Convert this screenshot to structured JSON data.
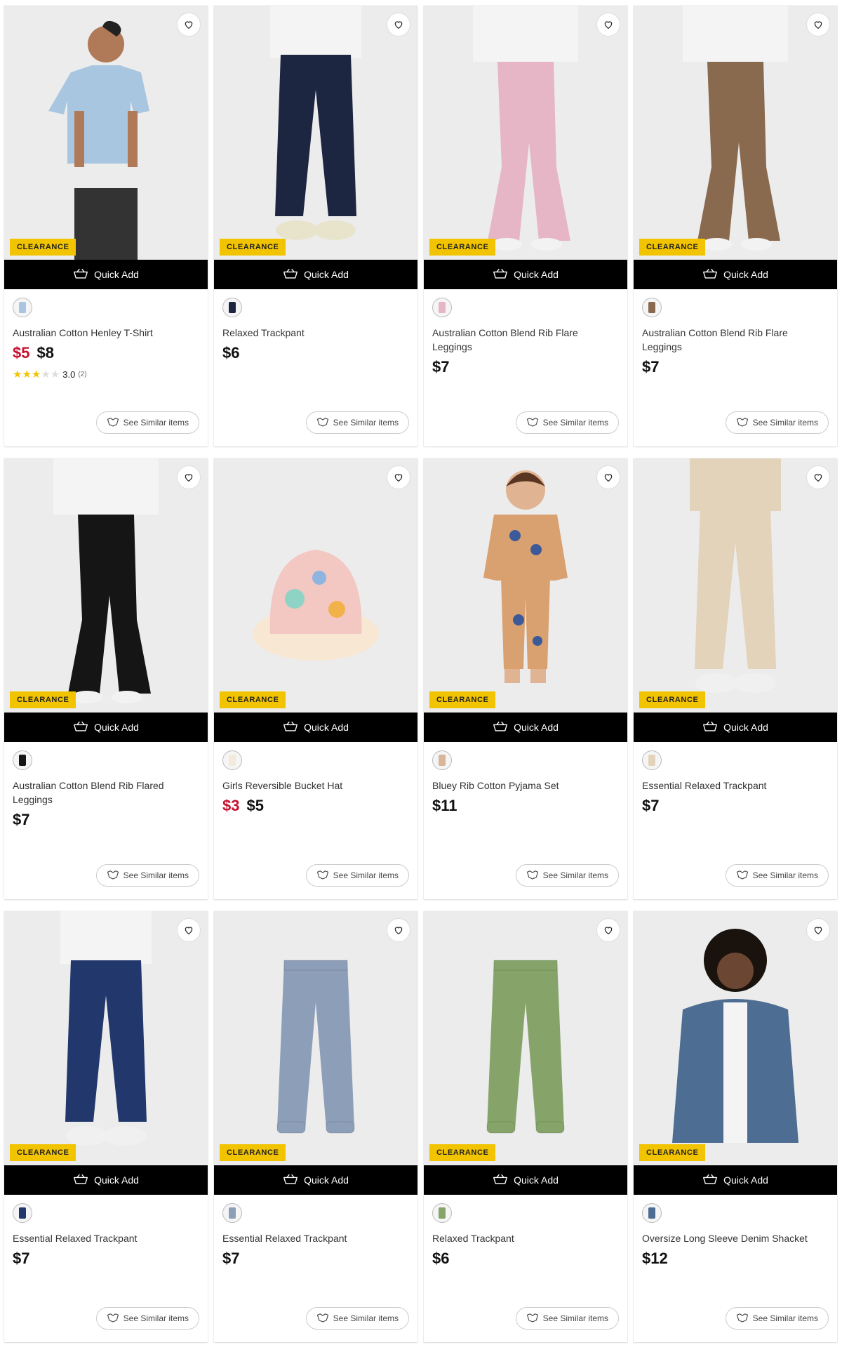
{
  "common": {
    "badge": "CLEARANCE",
    "quick_add": "Quick Add",
    "see_similar": "See Similar items"
  },
  "colors": {
    "badge_bg": "#f2c400",
    "sale_price": "#c8102e",
    "quick_add_bg": "#000000"
  },
  "products": [
    {
      "name": "Australian Cotton Henley T-Shirt",
      "sale_price": "$5",
      "price": "$8",
      "rating": "3.0",
      "rating_count": "(2)",
      "stars": 3,
      "swatch": "#a8c6e0",
      "photo": {
        "kind": "tee",
        "top": "#a8c6e0",
        "bottom": "#333333",
        "skin": "#b07a58"
      }
    },
    {
      "name": "Relaxed Trackpant",
      "sale_price": "",
      "price": "$6",
      "photo": {
        "kind": "pants",
        "top": "#f4f4f4",
        "bottom": "#1c2640",
        "shoe": "#e8e4cc"
      },
      "swatch": "#1c2640"
    },
    {
      "name": "Australian Cotton Blend Rib Flare Leggings",
      "sale_price": "",
      "price": "$7",
      "photo": {
        "kind": "flare",
        "top": "#f4f4f4",
        "bottom": "#e6b6c6",
        "shoe": "#f2f2f2"
      },
      "swatch": "#e6b6c6"
    },
    {
      "name": "Australian Cotton Blend Rib Flare Leggings",
      "sale_price": "",
      "price": "$7",
      "photo": {
        "kind": "flare",
        "top": "#f4f4f4",
        "bottom": "#8a6a4e",
        "shoe": "#f2f2f2"
      },
      "swatch": "#8a6a4e"
    },
    {
      "name": "Australian Cotton Blend Rib Flared Leggings",
      "sale_price": "",
      "price": "$7",
      "photo": {
        "kind": "flare",
        "top": "#f4f4f4",
        "bottom": "#151515",
        "shoe": "#f2f2f2"
      },
      "swatch": "#151515"
    },
    {
      "name": "Girls Reversible Bucket Hat",
      "sale_price": "$3",
      "price": "$5",
      "photo": {
        "kind": "hat",
        "top": "#f7e7d3",
        "bottom": "#f3c7c2",
        "shoe": "#8ed3c6"
      },
      "swatch": "#f4ead9"
    },
    {
      "name": "Bluey Rib Cotton Pyjama Set",
      "sale_price": "",
      "price": "$11",
      "photo": {
        "kind": "pyjama",
        "top": "#d9a070",
        "bottom": "#d9a070",
        "skin": "#e0b392"
      },
      "swatch": "#d9b59a"
    },
    {
      "name": "Essential Relaxed Trackpant",
      "sale_price": "",
      "price": "$7",
      "photo": {
        "kind": "pants",
        "top": "#e3d3bb",
        "bottom": "#e3d3bb",
        "shoe": "#f0f0f0"
      },
      "swatch": "#e3d3bb"
    },
    {
      "name": "Essential Relaxed Trackpant",
      "sale_price": "",
      "price": "$7",
      "photo": {
        "kind": "pants",
        "top": "#f4f4f4",
        "bottom": "#22376b",
        "shoe": "#f0f0f0"
      },
      "swatch": "#22376b"
    },
    {
      "name": "Essential Relaxed Trackpant",
      "sale_price": "",
      "price": "$7",
      "photo": {
        "kind": "flat",
        "bottom": "#8d9fb8"
      },
      "swatch": "#8d9fb8"
    },
    {
      "name": "Relaxed Trackpant",
      "sale_price": "",
      "price": "$6",
      "photo": {
        "kind": "flat",
        "bottom": "#86a46a"
      },
      "swatch": "#86a46a"
    },
    {
      "name": "Oversize Long Sleeve Denim Shacket",
      "sale_price": "",
      "price": "$12",
      "photo": {
        "kind": "jacket",
        "top": "#4e6d92",
        "bottom": "#f4f4f4",
        "skin": "#6b4632"
      },
      "swatch": "#4e6d92"
    }
  ]
}
